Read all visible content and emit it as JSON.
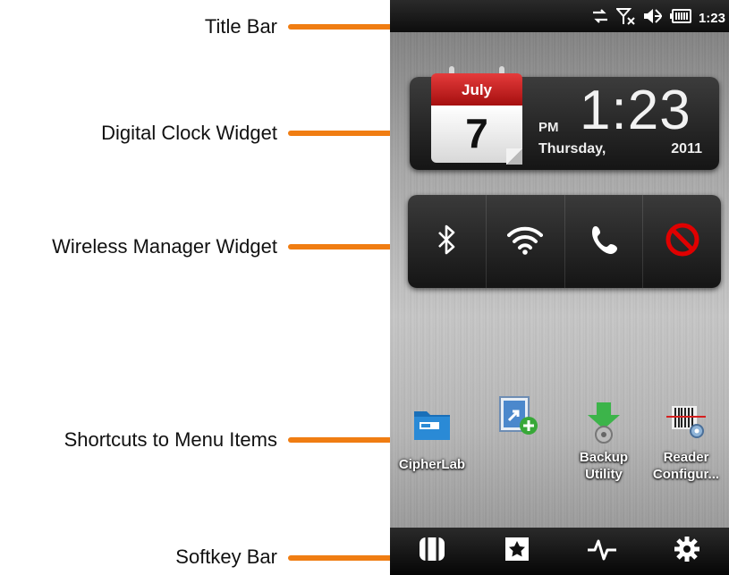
{
  "annotations": {
    "title_bar": "Title Bar",
    "digital_clock_widget": "Digital Clock Widget",
    "wireless_manager_widget": "Wireless Manager Widget",
    "shortcuts_to_menu_items": "Shortcuts to Menu Items",
    "softkey_bar": "Softkey Bar"
  },
  "status_bar": {
    "icons": [
      "data-sync-icon",
      "no-signal-icon",
      "speaker-muted-icon",
      "battery-icon"
    ],
    "time": "1:23"
  },
  "clock_widget": {
    "month": "July",
    "day": "7",
    "ampm": "PM",
    "time": "1:23",
    "weekday": "Thursday,",
    "year": "2011"
  },
  "wireless_manager": {
    "items": [
      "bluetooth-icon",
      "wifi-icon",
      "phone-icon",
      "prohibited-icon"
    ]
  },
  "shortcuts": [
    {
      "label": "CipherLab",
      "icon": "cipherlab-folder-icon"
    },
    {
      "label": "",
      "icon": "add-shortcut-icon"
    },
    {
      "label": "Backup\nUtility",
      "icon": "backup-utility-icon"
    },
    {
      "label": "Reader\nConfigur...",
      "icon": "reader-config-icon"
    }
  ],
  "softkeys": [
    "phone-book-icon",
    "favorites-icon",
    "activity-icon",
    "settings-gear-icon"
  ],
  "colors": {
    "accent_orange": "#f07d12",
    "calendar_red": "#c21a1a",
    "prohibited_red": "#e00000"
  }
}
